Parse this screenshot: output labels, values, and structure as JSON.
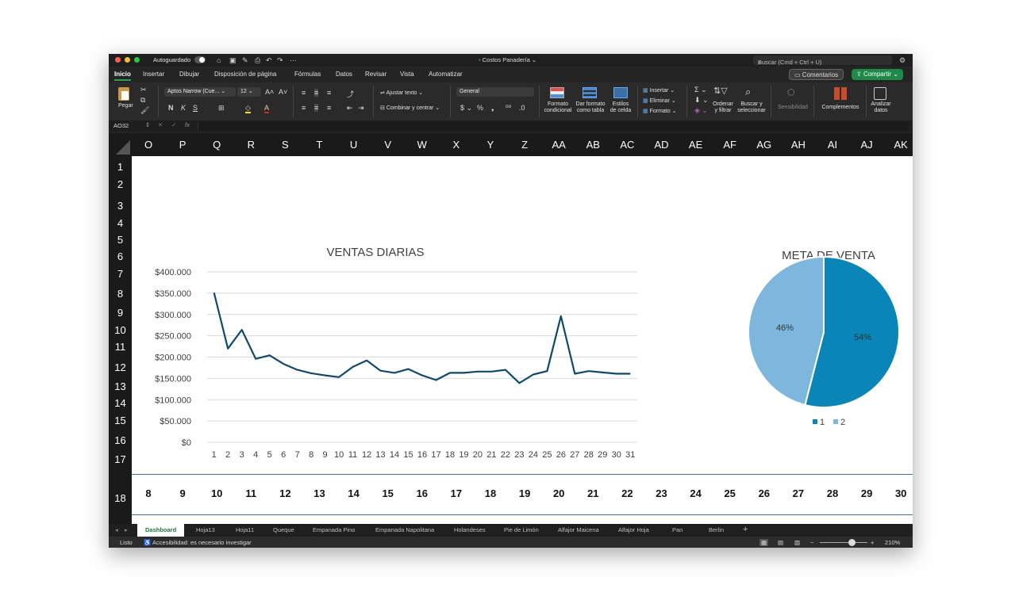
{
  "window": {
    "autosave": "Autoguardado",
    "file_title": "Costos Panadería",
    "search_placeholder": "Buscar (Cmd + Ctrl + U)"
  },
  "menu": {
    "tabs": [
      "Inicio",
      "Insertar",
      "Dibujar",
      "Disposición de página",
      "Fórmulas",
      "Datos",
      "Revisar",
      "Vista",
      "Automatizar"
    ],
    "comments": "Comentarios",
    "share": "Compartir"
  },
  "ribbon": {
    "paste": "Pegar",
    "font_name": "Aptos Narrow (Cue...",
    "font_size": "12",
    "wrap_text": "Ajustar texto",
    "merge_center": "Combinar y centrar",
    "number_format": "General",
    "cond_format": [
      "Formato",
      "condicional"
    ],
    "format_table": [
      "Dar formato",
      "como tabla"
    ],
    "cell_styles": [
      "Estilos",
      "de celda"
    ],
    "insert": "Insertar",
    "delete": "Eliminar",
    "format": "Formato",
    "sort_filter": [
      "Ordenar",
      "y filtrar"
    ],
    "find_select": [
      "Buscar y",
      "seleccionar"
    ],
    "sensitivity": "Sensibilidad",
    "addins": "Complementos",
    "analyze": [
      "Analizar",
      "datos"
    ]
  },
  "formula_bar": {
    "cell_ref": "AO32",
    "fx": "fx"
  },
  "columns": [
    "O",
    "P",
    "Q",
    "R",
    "S",
    "T",
    "U",
    "V",
    "W",
    "X",
    "Y",
    "Z",
    "AA",
    "AB",
    "AC",
    "AD",
    "AE",
    "AF",
    "AG",
    "AH",
    "AI",
    "AJ",
    "AK"
  ],
  "rows": [
    "1",
    "2",
    "3",
    "4",
    "5",
    "6",
    "7",
    "8",
    "9",
    "10",
    "11",
    "12",
    "13",
    "14",
    "15",
    "16",
    "17",
    "18"
  ],
  "row18_values": [
    "8",
    "9",
    "10",
    "11",
    "12",
    "13",
    "14",
    "15",
    "16",
    "17",
    "18",
    "19",
    "20",
    "21",
    "22",
    "23",
    "24",
    "25",
    "26",
    "27",
    "28",
    "29",
    "30"
  ],
  "chart_data": [
    {
      "type": "line",
      "title": "VENTAS DIARIAS",
      "xlabel": "",
      "ylabel": "",
      "categories": [
        "1",
        "2",
        "3",
        "4",
        "5",
        "6",
        "7",
        "8",
        "9",
        "10",
        "11",
        "12",
        "13",
        "14",
        "15",
        "16",
        "17",
        "18",
        "19",
        "20",
        "21",
        "22",
        "23",
        "24",
        "25",
        "26",
        "27",
        "28",
        "29",
        "30",
        "31"
      ],
      "values": [
        351000,
        220000,
        264000,
        196000,
        204000,
        184000,
        170000,
        162000,
        157000,
        153000,
        177000,
        192000,
        168000,
        163000,
        172000,
        157000,
        146000,
        163000,
        163000,
        166000,
        166000,
        170000,
        139000,
        159000,
        167000,
        296000,
        161000,
        167000,
        164000,
        161000,
        161000
      ],
      "y_ticks": [
        "$400.000",
        "$350.000",
        "$300.000",
        "$250.000",
        "$200.000",
        "$150.000",
        "$100.000",
        "$50.000",
        "$0"
      ],
      "ylim": [
        0,
        400000
      ],
      "grid": true,
      "color": "#0e4a6e"
    },
    {
      "type": "pie",
      "title": "META DE VENTA",
      "categories": [
        "1",
        "2"
      ],
      "values": [
        54,
        46
      ],
      "labels": [
        "54%",
        "46%"
      ],
      "colors": [
        "#0a85b7",
        "#7db7dd"
      ],
      "legend": "bottom"
    }
  ],
  "sheet_tabs": [
    "Dashboard",
    "Hoja13",
    "Hoja11",
    "Queque",
    "Empanada Pino",
    "Empanada Napolitana",
    "Holandeses",
    "Pie de Limón",
    "Alfajor Maicena",
    "Alfajor Hoja",
    "Pan",
    "Berlin"
  ],
  "status": {
    "ready": "Listo",
    "accessibility": "Accesibilidad: es necesario investigar",
    "zoom": "210%"
  }
}
